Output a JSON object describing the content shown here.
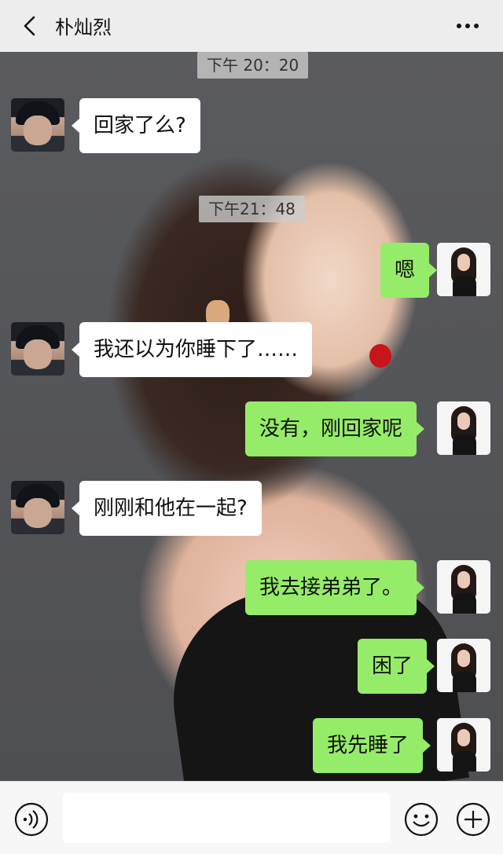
{
  "header": {
    "title": "朴灿烈",
    "back_icon": "back-chevron-icon",
    "more_icon": "more-dots-icon"
  },
  "messages": [
    {
      "type": "time",
      "text": "下午 20：20"
    },
    {
      "type": "in",
      "text": "回家了么?"
    },
    {
      "type": "time",
      "text": "下午21：48"
    },
    {
      "type": "out",
      "text": "嗯"
    },
    {
      "type": "in",
      "text": "我还以为你睡下了……"
    },
    {
      "type": "out",
      "text": "没有，刚回家呢"
    },
    {
      "type": "in",
      "text": "刚刚和他在一起?"
    },
    {
      "type": "out",
      "text": "我去接弟弟了。"
    },
    {
      "type": "out",
      "text": "困了"
    },
    {
      "type": "out",
      "text": "我先睡了"
    }
  ],
  "footer": {
    "voice_icon": "voice-icon",
    "emoji_icon": "emoji-icon",
    "plus_icon": "plus-icon",
    "input_value": ""
  },
  "colors": {
    "outgoing_bubble": "#95ec69",
    "incoming_bubble": "#ffffff",
    "header_bg": "#ededed"
  }
}
